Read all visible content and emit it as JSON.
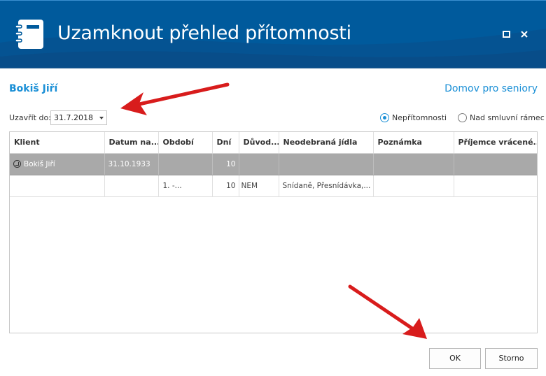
{
  "window": {
    "title": "Uzamknout přehled přítomnosti",
    "icons": {
      "app": "notebook-icon",
      "maximize": "maximize-icon",
      "close": "close-icon"
    },
    "colors": {
      "titlebar": "#005a9c",
      "accent": "#1a8fd6",
      "group_row": "#a9a9a9"
    }
  },
  "header": {
    "client_name": "Bokiš Jiří",
    "facility": "Domov pro seniory"
  },
  "filter": {
    "close_to_label": "Uzavřít do:",
    "close_to_value": "31.7.2018",
    "radio_absence": "Nepřítomnosti",
    "radio_absence_selected": true,
    "radio_over_limit": "Nad smluvní rámec",
    "radio_over_limit_selected": false
  },
  "grid": {
    "columns": [
      "Klient",
      "Datum na...",
      "Období",
      "Dní",
      "Důvod...",
      "Neodebraná jídla",
      "Poznámka",
      "Příjemce vrácené..."
    ],
    "group_row": [
      "Bokiš Jiří",
      "31.10.1933",
      "",
      "10",
      "",
      "",
      "",
      ""
    ],
    "rows": [
      [
        "",
        "",
        "1. -...",
        "10",
        "NEM",
        "Snídaně, Přesnídávka,...",
        "",
        ""
      ]
    ]
  },
  "buttons": {
    "ok": "OK",
    "cancel": "Storno"
  }
}
